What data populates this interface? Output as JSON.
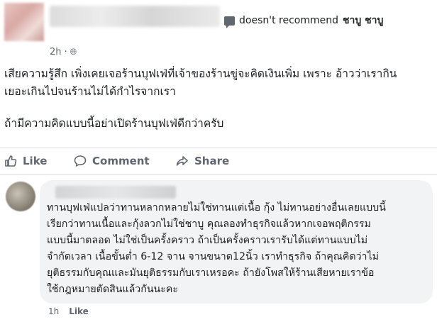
{
  "post": {
    "recommendation_text": "doesn't recommend",
    "page_name": "ชาบู ชาบู",
    "time": "2h",
    "text_lines": [
      "เสียความรู้สึก เพิ่งเคยเจอร้านบุฟเฟ่ที่เจ้าของร้านขู่จะคิดเงินเพิ่ม เพราะ อ้าวว่าเรากิน",
      "เยอะเกินไปจนร้านไม่ได้กำไรจากเรา"
    ],
    "text_line_2": "ถ้ามีความคิดแบบนี้อย่าเปิดร้านบุฟเฟ่ดีกว่าครับ"
  },
  "actions": {
    "like_label": "Like",
    "comment_label": "Comment",
    "share_label": "Share"
  },
  "comment": {
    "lines": [
      "ทานบุฟเฟ่แปลว่าทานหลากหลายไม่ใช่ทานแต่เนื้อ กุ้ง ไม่ทานอย่างอื่นเลยแบบนี้",
      "เรียกว่าทานเนื้อและกุ้งลวกไม่ใช่ชาบู คุณลองทำธุรกิจแล้วหากเจอพฤติกรรม",
      "แบบนี้มาตลอด ไม่ใช่เป็นครั้งคราว ถ้าเป็นครั้งคราวเรารับได้แต่ทานแบบไม่",
      "จำกัดเวลา เนื้อขั้นต่ำ 6-12 จาน จานขนาด12นิ้ว เราทำธุรกิจ ถ้าคุณคิดว่าไม่",
      "ยุติธรรมกับคุณและมันยุติธรรมกับเราเหรอคะ ถ้ายังโพสให้ร้านเสียหายเราข้อ",
      "ใช้กฎหมายตัดสินแล้วกันนะคะ"
    ],
    "time": "1h",
    "like_label": "Like"
  }
}
